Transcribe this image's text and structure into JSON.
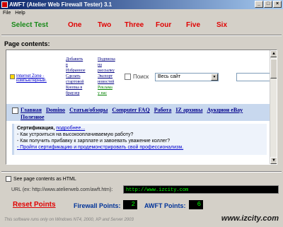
{
  "window": {
    "title": "AWFT (Atelier Web Firewall Tester) 3.1"
  },
  "menu": {
    "file": "File",
    "help": "Help"
  },
  "tabs": [
    "Select Test",
    "One",
    "Two",
    "Three",
    "Four",
    "Five",
    "Six"
  ],
  "page_contents_label": "Page contents:",
  "browser": {
    "zone_text": "Internet Zone - компьютерный.",
    "top_links_col1": [
      "Добавить",
      "в",
      "Избранное",
      "Сделать",
      "стартовой",
      "Кнопка в",
      "браузер"
    ],
    "top_links_col2": [
      "Подписка",
      "на",
      "рассылку",
      "Экспорт",
      "новостей",
      "Реклама",
      "у нас"
    ],
    "search_label": "Поиск",
    "search_select": "Весь сайт",
    "nav_links": [
      "Главная",
      "Domino",
      "Статьи/обзоры",
      "Computer FAQ",
      "Работа",
      "IZ архивы",
      "Аукцион eBay",
      "Полезное"
    ],
    "cert_title": "Сертификация,",
    "cert_more": "подробнее...",
    "cert_lines": [
      "- Как устроиться на высокооплачиваемую работу?",
      "- Как получить прибавку к зарплате и завоевать уважение коллег?",
      "- Пройти сертификацию и продемонстрировать свой профессионализм."
    ]
  },
  "see_html_label": "See page contents as HTML",
  "url_label": "URL (ex: http://www.atelierweb.com/awft.htm):",
  "url_value": "http://www.izcity.com",
  "reset_label": "Reset Points",
  "firewall_points_label": "Firewall Points:",
  "firewall_points_value": "2",
  "awft_points_label": "AWFT Points:",
  "awft_points_value": "6",
  "footer_text": "This software runs only on Windows NT4, 2000, XP and Server 2003",
  "watermark": "www.izcity.com",
  "colors": {
    "title_start": "#0a246a",
    "tab_red": "#e00000",
    "tab_green": "#1a8a1a",
    "points_blue": "#003399"
  }
}
